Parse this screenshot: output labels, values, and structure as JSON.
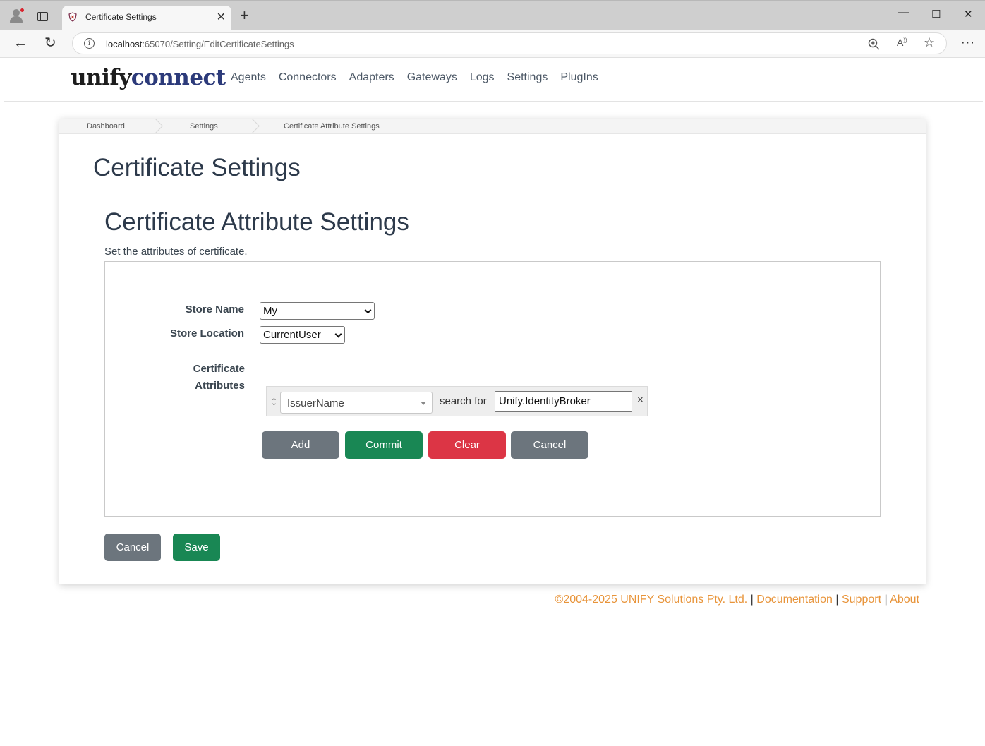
{
  "browser": {
    "tab_title": "Certificate Settings",
    "url_host": "localhost",
    "url_rest": ":65070/Setting/EditCertificateSettings"
  },
  "brand": {
    "part1": "unify",
    "part2": "connect"
  },
  "nav": {
    "agents": "Agents",
    "connectors": "Connectors",
    "adapters": "Adapters",
    "gateways": "Gateways",
    "logs": "Logs",
    "settings": "Settings",
    "plugins": "PlugIns"
  },
  "breadcrumb": {
    "dashboard": "Dashboard",
    "settings": "Settings",
    "current": "Certificate Attribute Settings"
  },
  "page": {
    "title": "Certificate Settings",
    "section_title": "Certificate Attribute Settings",
    "description": "Set the attributes of certificate."
  },
  "form": {
    "store_name_label": "Store Name",
    "store_name_value": "My",
    "store_location_label": "Store Location",
    "store_location_value": "CurrentUser",
    "cert_attr_label_1": "Certificate",
    "cert_attr_label_2": "Attributes",
    "attr_select_value": "IssuerName",
    "search_for_label": "search for",
    "attr_input_value": "Unify.IdentityBroker",
    "remove_symbol": "×"
  },
  "attr_buttons": {
    "add": "Add",
    "commit": "Commit",
    "clear": "Clear",
    "cancel": "Cancel"
  },
  "page_buttons": {
    "cancel": "Cancel",
    "save": "Save"
  },
  "footer": {
    "copyright": "©2004-2025 UNIFY Solutions Pty. Ltd.",
    "documentation": "Documentation",
    "support": "Support",
    "about": "About",
    "separator": "|"
  },
  "colors": {
    "accent_orange": "#e8943a",
    "brand_navy": "#2c3a7a",
    "btn_gray": "#6c757d",
    "btn_green": "#198754",
    "btn_red": "#dc3545"
  }
}
